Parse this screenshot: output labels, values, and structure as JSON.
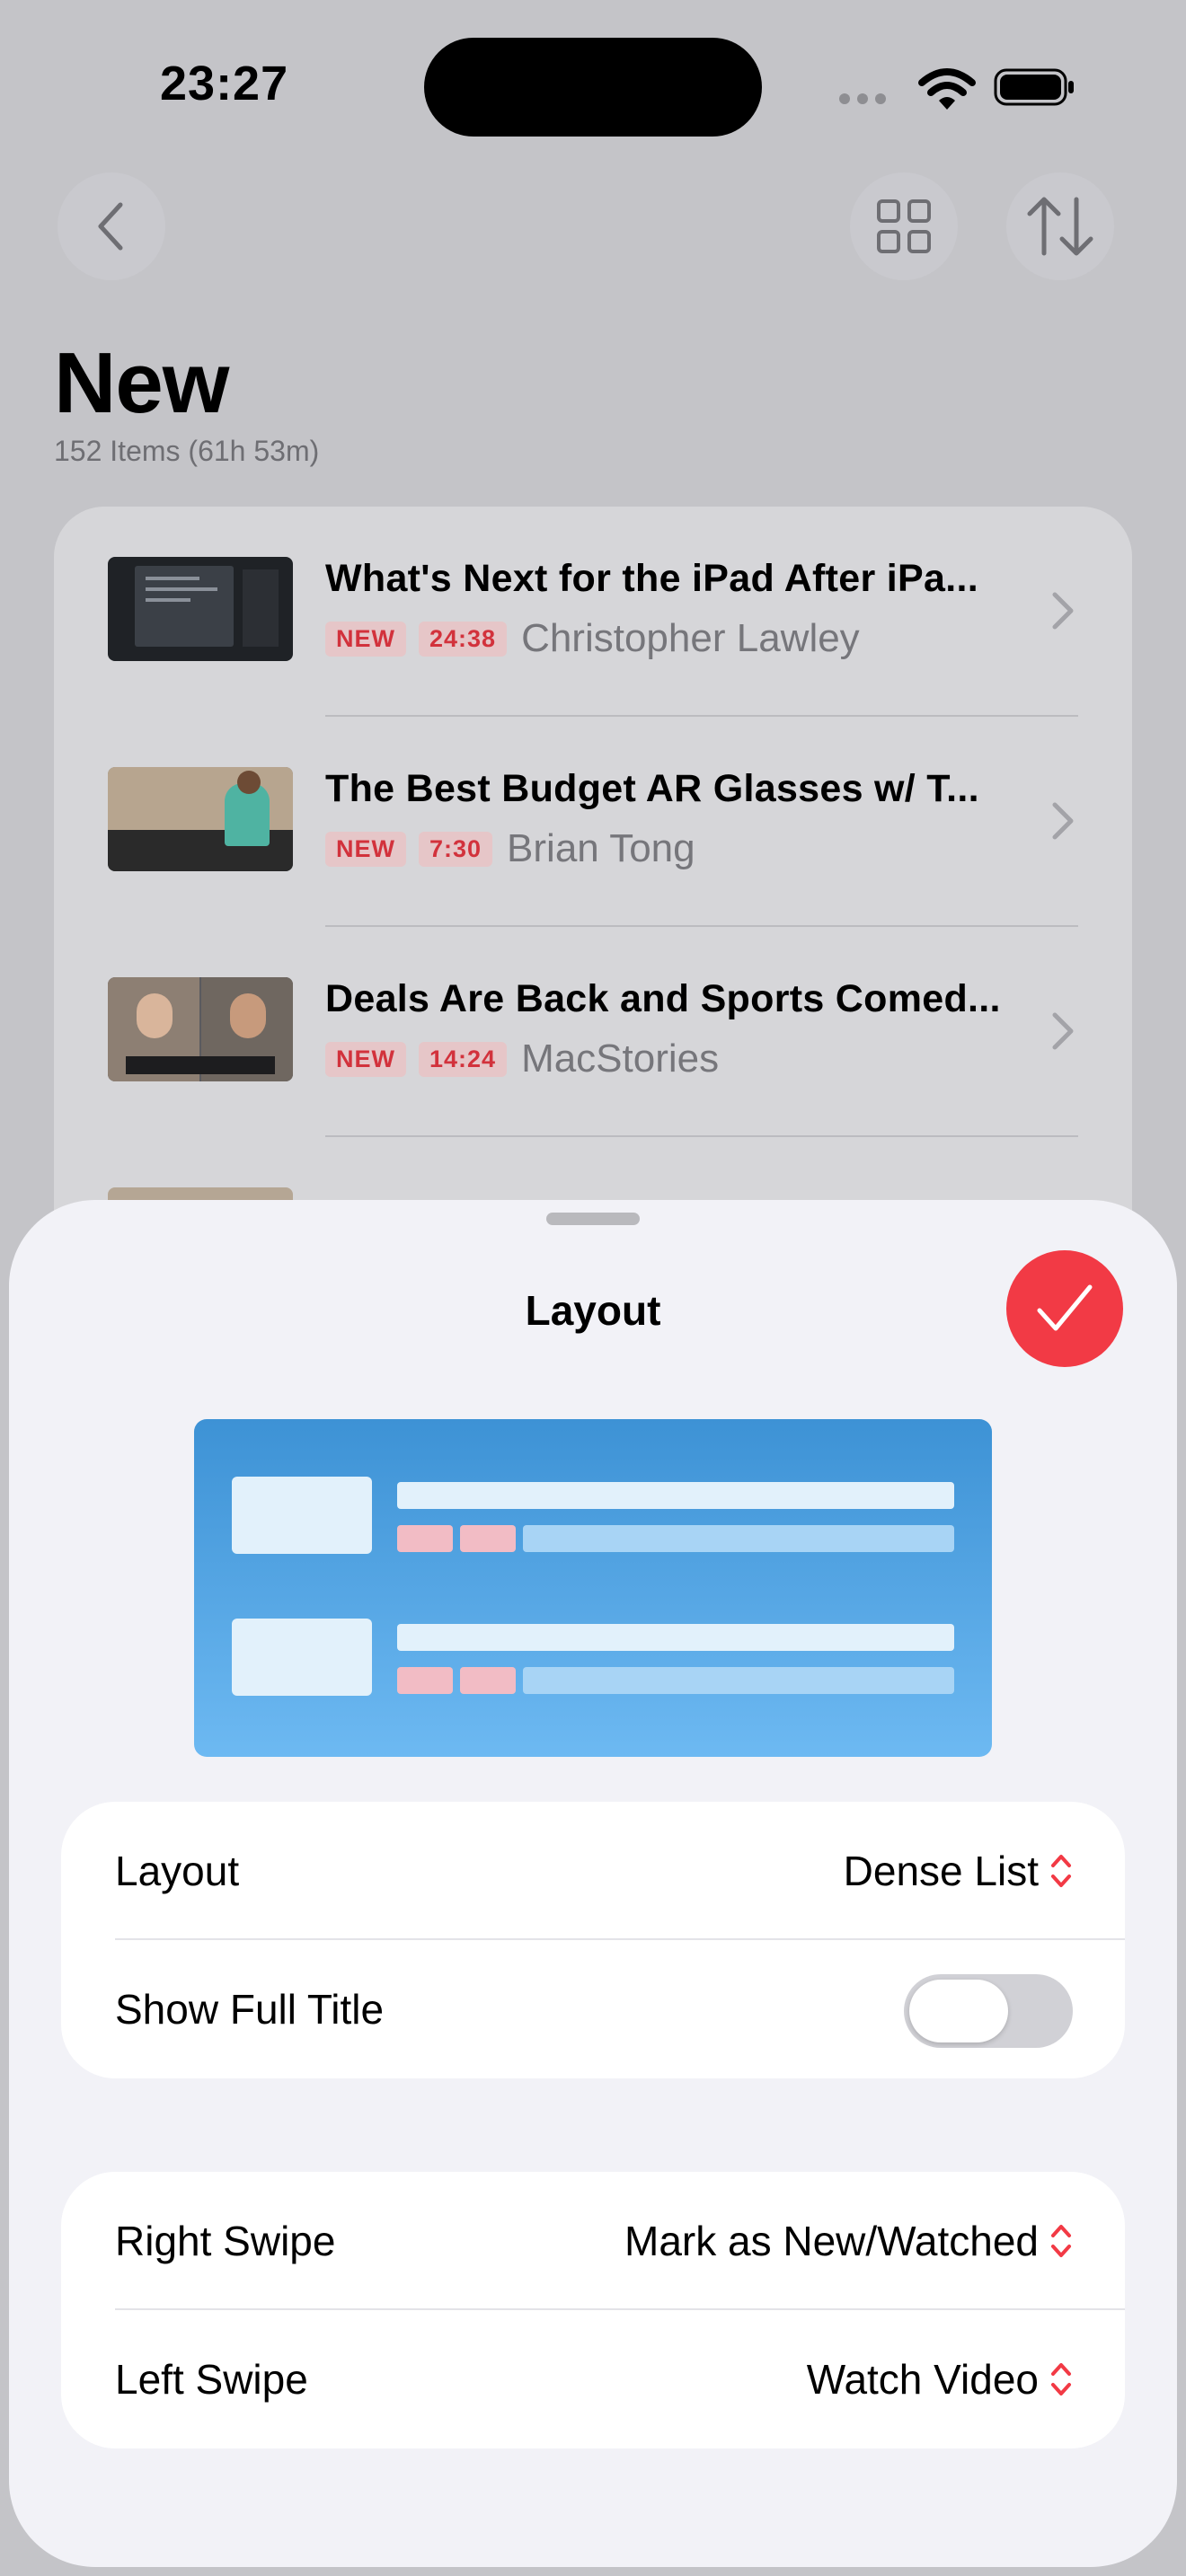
{
  "status_bar": {
    "time": "23:27",
    "icons": [
      "cellular-signal-icon",
      "wifi-icon",
      "battery-icon"
    ]
  },
  "nav": {
    "icons": [
      "chevron-left-icon",
      "grid-icon",
      "sort-arrows-icon"
    ]
  },
  "page": {
    "title": "New",
    "subtitle": "152 Items (61h 53m)"
  },
  "videos": [
    {
      "title": "What's Next for the iPad After iPa...",
      "badge": "NEW",
      "duration": "24:38",
      "channel": "Christopher Lawley"
    },
    {
      "title": "The Best Budget AR Glasses w/ T...",
      "badge": "NEW",
      "duration": "7:30",
      "channel": "Brian Tong"
    },
    {
      "title": "Deals Are Back and Sports Comed...",
      "badge": "NEW",
      "duration": "14:24",
      "channel": "MacStories"
    }
  ],
  "sheet": {
    "title": "Layout",
    "done_icon": "checkmark-icon",
    "settings": [
      {
        "label": "Layout",
        "value": "Dense List"
      },
      {
        "label": "Show Full Title",
        "toggle_on": false
      }
    ],
    "swipes": [
      {
        "label": "Right Swipe",
        "value": "Mark as New/Watched"
      },
      {
        "label": "Left Swipe",
        "value": "Watch Video"
      }
    ]
  },
  "colors": {
    "accent": "#f23a45",
    "badge_text": "#d2323c",
    "preview_top": "#3d92d5",
    "preview_bottom": "#6db9f2"
  }
}
